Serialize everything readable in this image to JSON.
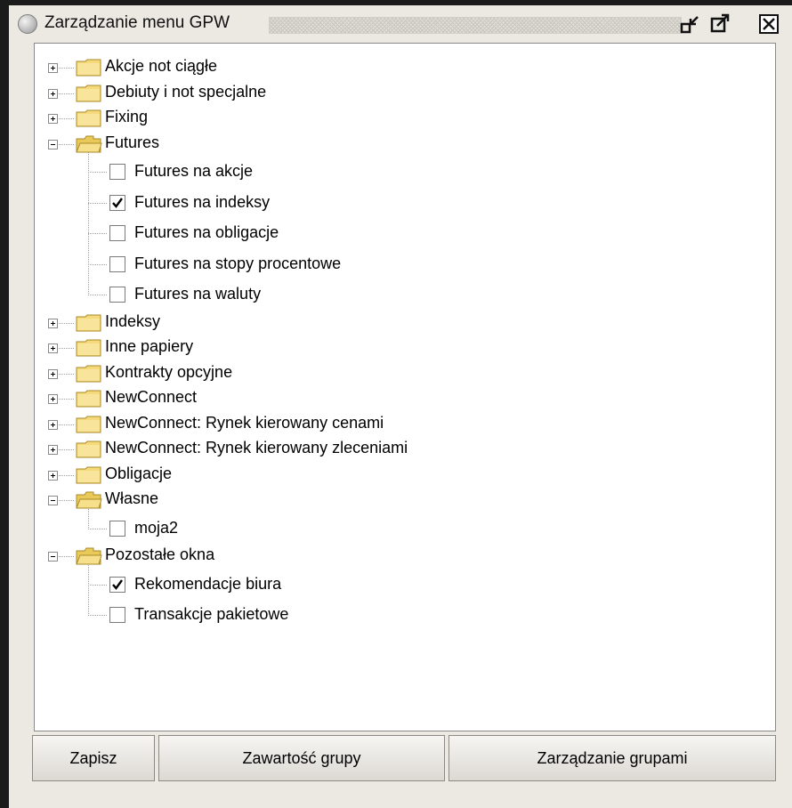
{
  "window": {
    "title": "Zarządzanie menu GPW"
  },
  "tree": {
    "groups_top": [
      {
        "label": "Akcje not ciągłe",
        "expanded": false
      },
      {
        "label": "Debiuty i not specjalne",
        "expanded": false
      },
      {
        "label": "Fixing",
        "expanded": false
      }
    ],
    "futures": {
      "label": "Futures",
      "expanded": true,
      "items": [
        {
          "label": "Futures na akcje",
          "checked": false
        },
        {
          "label": "Futures na indeksy",
          "checked": true
        },
        {
          "label": "Futures na obligacje",
          "checked": false
        },
        {
          "label": "Futures na stopy procentowe",
          "checked": false
        },
        {
          "label": "Futures na waluty",
          "checked": false
        }
      ]
    },
    "groups_mid": [
      {
        "label": "Indeksy",
        "expanded": false
      },
      {
        "label": "Inne papiery",
        "expanded": false
      },
      {
        "label": "Kontrakty opcyjne",
        "expanded": false
      },
      {
        "label": "NewConnect",
        "expanded": false
      },
      {
        "label": "NewConnect: Rynek kierowany cenami",
        "expanded": false
      },
      {
        "label": "NewConnect: Rynek kierowany zleceniami",
        "expanded": false
      },
      {
        "label": "Obligacje",
        "expanded": false
      }
    ],
    "wlasne": {
      "label": "Własne",
      "expanded": true,
      "items": [
        {
          "label": "moja2",
          "checked": false
        }
      ]
    },
    "pozostale": {
      "label": "Pozostałe okna",
      "expanded": true,
      "items": [
        {
          "label": "Rekomendacje biura",
          "checked": true
        },
        {
          "label": "Transakcje pakietowe",
          "checked": false
        }
      ]
    }
  },
  "buttons": {
    "save": "Zapisz",
    "group_content": "Zawartość grupy",
    "manage_groups": "Zarządzanie grupami"
  },
  "icons": {
    "title": "circle-icon",
    "minimize": "minimize-icon",
    "maximize": "maximize-icon",
    "close": "close-icon",
    "folder_closed": "folder-closed-icon",
    "folder_open": "folder-open-icon",
    "check": "check-icon"
  },
  "colors": {
    "window_bg": "#ece9e3",
    "folder": "#f5d97a"
  }
}
